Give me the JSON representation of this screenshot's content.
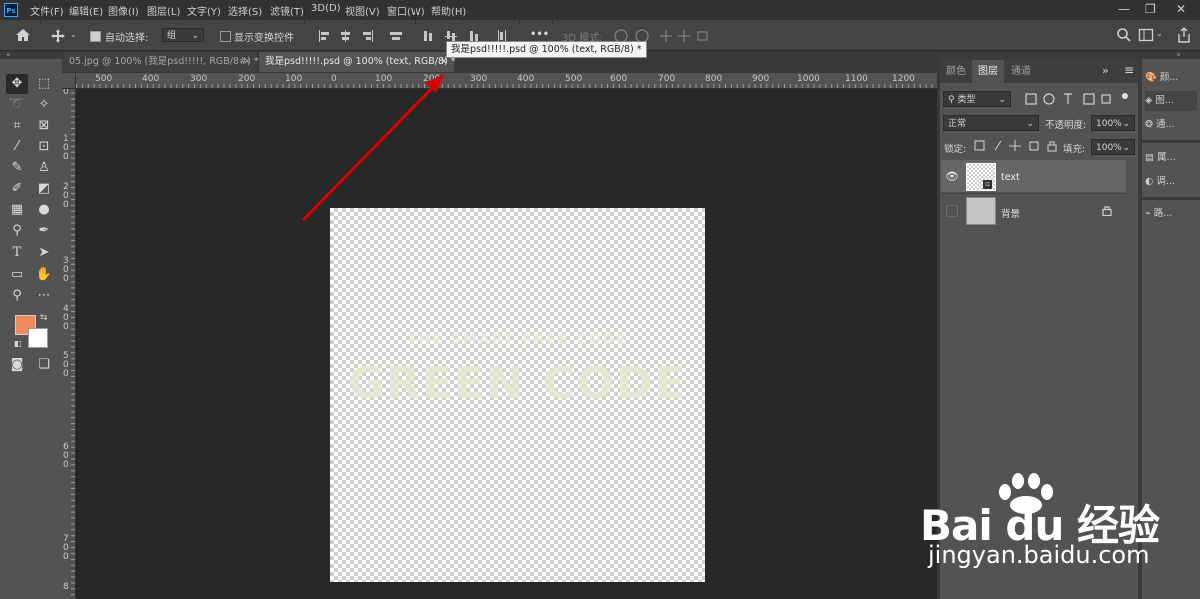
{
  "app": {
    "logo": "Ps"
  },
  "menu": [
    "文件(F)",
    "编辑(E)",
    "图像(I)",
    "图层(L)",
    "文字(Y)",
    "选择(S)",
    "滤镜(T)",
    "3D(D)",
    "视图(V)",
    "窗口(W)",
    "帮助(H)"
  ],
  "window_controls": {
    "minimize": "—",
    "restore": "❐",
    "close": "✕"
  },
  "options": {
    "auto_select_label": "自动选择:",
    "auto_select_checked": true,
    "auto_select_value": "组",
    "transform_label": "显示变换控件",
    "transform_checked": false,
    "mode_3d_label": "3D 模式:",
    "more_label": "•••"
  },
  "tabs": [
    {
      "label": "05.jpg @ 100% (我是psd!!!!!, RGB/8#) *",
      "close": "×"
    },
    {
      "label": "我是psd!!!!!.psd @ 100% (text, RGB/8) *",
      "close": "×"
    }
  ],
  "tooltip": "我是psd!!!!!.psd @ 100% (text, RGB/8) *",
  "ruler_top_labels": [
    "500",
    "400",
    "300",
    "200",
    "100",
    "0",
    "100",
    "200",
    "300",
    "400",
    "500",
    "600",
    "700",
    "800",
    "900",
    "1000",
    "1100",
    "1200"
  ],
  "ruler_left_labels": [
    "0",
    "1\n0\n0",
    "2\n0\n0",
    "3\n0\n0",
    "4\n0\n0",
    "5\n0\n0",
    "6\n0\n0",
    "7\n0\n0",
    "8"
  ],
  "canvas": {
    "small_text": "THE SMART FREE CODE",
    "big_text": "GREEN CODE"
  },
  "colors": {
    "foreground": "#ef8a5c",
    "background": "#ffffff",
    "arrow": "#d80000",
    "accent": "#31a8ff"
  },
  "panels": {
    "tabs": [
      "颜色",
      "图层",
      "通道"
    ],
    "active_tab": "图层",
    "menu_icon": "≡",
    "collapse": "»",
    "filter_label": "类型",
    "blend_mode": "正常",
    "opacity_label": "不透明度:",
    "opacity": "100%",
    "lock_label": "锁定:",
    "fill_label": "填充:",
    "fill": "100%",
    "layers": [
      {
        "name": "text",
        "visible": true,
        "selected": true
      },
      {
        "name": "背景",
        "visible": false,
        "locked": true
      }
    ]
  },
  "side": [
    "颜...",
    "图...",
    "通...",
    "属...",
    "调...",
    "路..."
  ],
  "watermark": {
    "brand": "Bai du 经验",
    "url": "jingyan.baidu.com"
  }
}
